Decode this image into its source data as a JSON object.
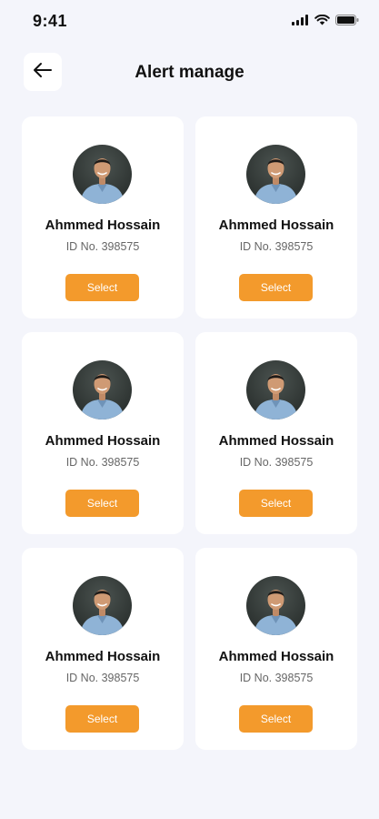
{
  "status_bar": {
    "time": "9:41",
    "icons": [
      "signal-icon",
      "wifi-icon",
      "battery-icon"
    ]
  },
  "header": {
    "back_icon": "arrow-left-icon",
    "title": "Alert manage"
  },
  "colors": {
    "background": "#f4f5fb",
    "card": "#ffffff",
    "accent": "#f39a2c"
  },
  "people": [
    {
      "name": "Ahmmed Hossain",
      "id_text": "ID No. 398575",
      "button_label": "Select"
    },
    {
      "name": "Ahmmed Hossain",
      "id_text": "ID No. 398575",
      "button_label": "Select"
    },
    {
      "name": "Ahmmed Hossain",
      "id_text": "ID No. 398575",
      "button_label": "Select"
    },
    {
      "name": "Ahmmed Hossain",
      "id_text": "ID No. 398575",
      "button_label": "Select"
    },
    {
      "name": "Ahmmed Hossain",
      "id_text": "ID No. 398575",
      "button_label": "Select"
    },
    {
      "name": "Ahmmed Hossain",
      "id_text": "ID No. 398575",
      "button_label": "Select"
    }
  ]
}
